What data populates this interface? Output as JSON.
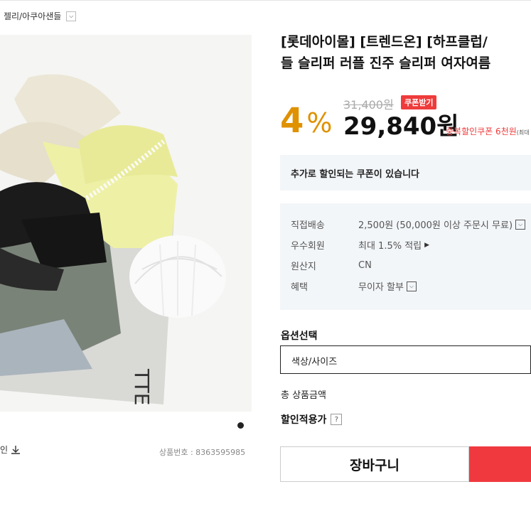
{
  "breadcrumb": {
    "label": "젤리/아쿠아샌들",
    "dropdown_icon": "chevron-down-icon"
  },
  "product": {
    "title_line1": "[롯데아이몰] [트렌드온] [하프클럽/",
    "title_line2": "들 슬리퍼 러플 진주 슬리퍼 여자여름",
    "product_number_label": "상품번호 : 8363595985",
    "image_alt": "sandals photo",
    "download_label": "인"
  },
  "pricing": {
    "discount_rate": "4",
    "discount_symbol": "%",
    "original_price": "31,400원",
    "coupon_button": "쿠폰받기",
    "sale_price": "29,840원",
    "duplicate_coupon": "중복할인쿠폰 6천원",
    "duplicate_coupon_tail": "(최대"
  },
  "coupon_notice": "추가로 할인되는 쿠폰이 있습니다",
  "info": {
    "shipping_label": "직접배송",
    "shipping_value": "2,500원 (50,000원 이상 주문시 무료)",
    "member_label": "우수회원",
    "member_value": "최대 1.5% 적립",
    "origin_label": "원산지",
    "origin_value": "CN",
    "benefit_label": "혜택",
    "benefit_value": "무이자 할부"
  },
  "options": {
    "label": "옵션선택",
    "select_value": "색상/사이즈"
  },
  "total_label": "총 상품금액",
  "discount_applied_label": "할인적용가",
  "help_icon": "?",
  "buttons": {
    "cart": "장바구니"
  },
  "colors": {
    "accent_orange": "#e09100",
    "accent_red": "#ef3b3b",
    "panel_bg": "#f3f6f9"
  }
}
